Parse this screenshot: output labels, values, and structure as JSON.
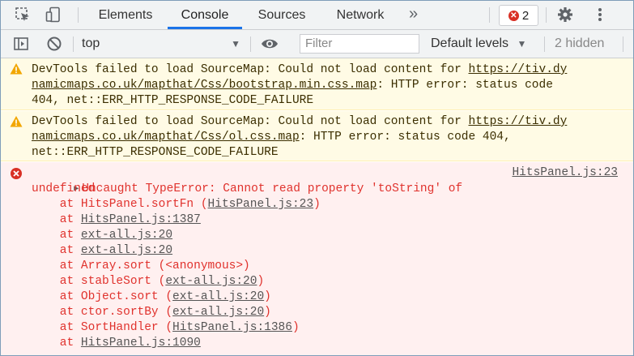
{
  "tabs": {
    "elements": "Elements",
    "console": "Console",
    "sources": "Sources",
    "network": "Network",
    "more": "»"
  },
  "errors_badge": {
    "count": "2"
  },
  "filterbar": {
    "context": "top",
    "filter_placeholder": "Filter",
    "levels": "Default levels",
    "hidden": "2 hidden"
  },
  "messages": [
    {
      "type": "warning",
      "l1_a": "DevTools failed to load SourceMap: Could not load content for ",
      "l1_b": "https://tiv.dy",
      "l2_a": "namicmaps.co.uk/mapthat/Css/bootstrap.min.css.map",
      "l2_b": ": HTTP error: status code",
      "l3": "404, net::ERR_HTTP_RESPONSE_CODE_FAILURE"
    },
    {
      "type": "warning",
      "l1_a": "DevTools failed to load SourceMap: Could not load content for ",
      "l1_b": "https://tiv.dy",
      "l2_a": "namicmaps.co.uk/mapthat/Css/ol.css.map",
      "l2_b": ": HTTP error: status code 404,",
      "l3": "net::ERR_HTTP_RESPONSE_CODE_FAILURE"
    }
  ],
  "error": {
    "line1": "Uncaught TypeError: Cannot read property 'toString' of",
    "line2": "undefined",
    "source": "HitsPanel.js:23",
    "stack": [
      {
        "pre": "at HitsPanel.sortFn (",
        "link": "HitsPanel.js:23",
        "post": ")"
      },
      {
        "pre": "at ",
        "link": "HitsPanel.js:1387",
        "post": ""
      },
      {
        "pre": "at ",
        "link": "ext-all.js:20",
        "post": ""
      },
      {
        "pre": "at ",
        "link": "ext-all.js:20",
        "post": ""
      },
      {
        "pre": "at Array.sort (<anonymous>)",
        "link": "",
        "post": ""
      },
      {
        "pre": "at stableSort (",
        "link": "ext-all.js:20",
        "post": ")"
      },
      {
        "pre": "at Object.sort (",
        "link": "ext-all.js:20",
        "post": ")"
      },
      {
        "pre": "at ctor.sortBy (",
        "link": "ext-all.js:20",
        "post": ")"
      },
      {
        "pre": "at SortHandler (",
        "link": "HitsPanel.js:1386",
        "post": ")"
      },
      {
        "pre": "at ",
        "link": "HitsPanel.js:1090",
        "post": ""
      }
    ]
  },
  "colors": {
    "warning_bg": "#fffbe5",
    "error_bg": "#fff0f0",
    "error_text": "#e0322d",
    "active_tab": "#1a73e8"
  },
  "icons": [
    "inspect-icon",
    "device-toggle-icon",
    "settings-gear-icon",
    "more-vert-icon",
    "sidebar-toggle-icon",
    "clear-console-icon",
    "eye-icon",
    "warning-icon",
    "error-icon"
  ]
}
